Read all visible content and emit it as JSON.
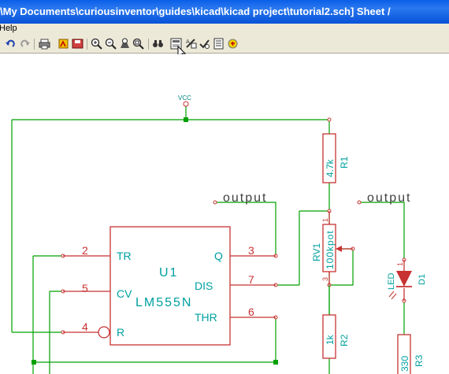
{
  "window": {
    "title": "\\My Documents\\curiousinventor\\guides\\kicad\\kicad project\\tutorial2.sch]  Sheet /"
  },
  "menu": {
    "items": [
      "Help"
    ]
  },
  "toolbar": {
    "buttons": [
      "undo-icon",
      "redo-icon",
      "print-icon",
      "plot-icon",
      "save-icon",
      "zoom-in-icon",
      "zoom-out-icon",
      "zoom-redraw-icon",
      "zoom-fit-icon",
      "find-icon",
      "netlist-icon",
      "annotate-icon",
      "erc-icon",
      "bom-icon",
      "footprint-icon"
    ]
  },
  "schematic": {
    "power": {
      "vcc": "VCC"
    },
    "labels": {
      "output_left": "output",
      "output_right": "output"
    },
    "u1": {
      "ref": "U1",
      "value": "LM555N"
    },
    "pins": {
      "tr_num": "2",
      "tr_name": "TR",
      "cv_num": "5",
      "cv_name": "CV",
      "r_num": "4",
      "r_name": "R",
      "q_num": "3",
      "q_name": "Q",
      "dis_num": "7",
      "dis_name": "DIS",
      "thr_num": "6",
      "thr_name": "THR"
    },
    "r1": {
      "ref": "R1",
      "value": "4.7k"
    },
    "rv1": {
      "ref": "RV1",
      "value": "100kpot",
      "pin1": "1",
      "pin3": "3"
    },
    "r2": {
      "ref": "R2",
      "value": "1k"
    },
    "d1": {
      "ref": "D1",
      "value": "LED",
      "pin1": "1"
    },
    "r3": {
      "ref": "R3",
      "value": "330"
    }
  },
  "colors": {
    "wire": "#00a000",
    "component": "#c83232",
    "pin_name": "#00a0a0",
    "label": "#404040",
    "titlebar": "#0a5fe8",
    "toolbar": "#ece9d8"
  }
}
